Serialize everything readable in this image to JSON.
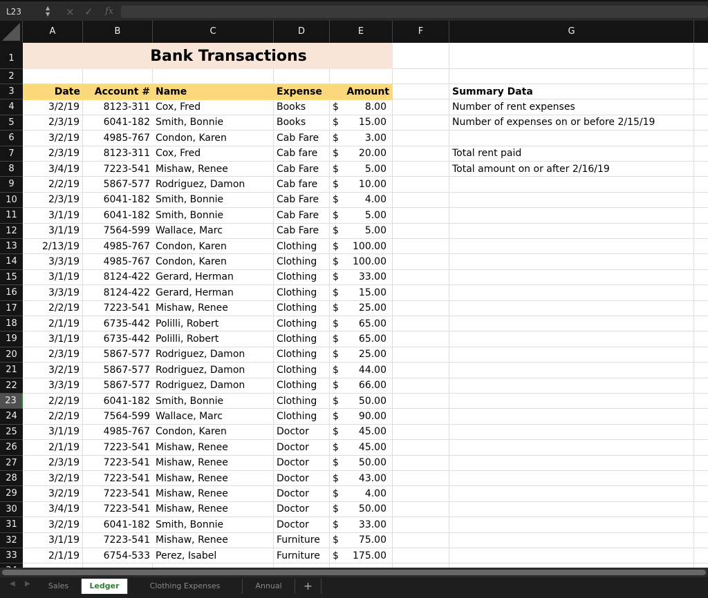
{
  "formula_bar": {
    "name_box": "L23",
    "cancel_icon": "×",
    "enter_icon": "✓",
    "fx_label": "fx",
    "formula": ""
  },
  "columns": [
    "A",
    "B",
    "C",
    "D",
    "E",
    "F",
    "G"
  ],
  "title": "Bank Transactions",
  "headers": {
    "date": "Date",
    "account": "Account #",
    "name": "Name",
    "expense": "Expense",
    "amount": "Amount"
  },
  "rows": [
    [
      "3/2/19",
      "8123-311",
      "Cox, Fred",
      "Books",
      "8.00"
    ],
    [
      "2/3/19",
      "6041-182",
      "Smith, Bonnie",
      "Books",
      "15.00"
    ],
    [
      "3/2/19",
      "4985-767",
      "Condon, Karen",
      "Cab Fare",
      "3.00"
    ],
    [
      "2/3/19",
      "8123-311",
      "Cox, Fred",
      "Cab fare",
      "20.00"
    ],
    [
      "3/4/19",
      "7223-541",
      "Mishaw, Renee",
      "Cab Fare",
      "5.00"
    ],
    [
      "2/2/19",
      "5867-577",
      "Rodriguez, Damon",
      "Cab fare",
      "10.00"
    ],
    [
      "2/3/19",
      "6041-182",
      "Smith, Bonnie",
      "Cab Fare",
      "4.00"
    ],
    [
      "3/1/19",
      "6041-182",
      "Smith, Bonnie",
      "Cab Fare",
      "5.00"
    ],
    [
      "3/1/19",
      "7564-599",
      "Wallace, Marc",
      "Cab Fare",
      "5.00"
    ],
    [
      "2/13/19",
      "4985-767",
      "Condon, Karen",
      "Clothing",
      "100.00"
    ],
    [
      "3/3/19",
      "4985-767",
      "Condon, Karen",
      "Clothing",
      "100.00"
    ],
    [
      "3/1/19",
      "8124-422",
      "Gerard, Herman",
      "Clothing",
      "33.00"
    ],
    [
      "3/3/19",
      "8124-422",
      "Gerard, Herman",
      "Clothing",
      "15.00"
    ],
    [
      "2/2/19",
      "7223-541",
      "Mishaw, Renee",
      "Clothing",
      "25.00"
    ],
    [
      "2/1/19",
      "6735-442",
      "Polilli, Robert",
      "Clothing",
      "65.00"
    ],
    [
      "3/1/19",
      "6735-442",
      "Polilli, Robert",
      "Clothing",
      "65.00"
    ],
    [
      "2/3/19",
      "5867-577",
      "Rodriguez, Damon",
      "Clothing",
      "25.00"
    ],
    [
      "3/2/19",
      "5867-577",
      "Rodriguez, Damon",
      "Clothing",
      "44.00"
    ],
    [
      "3/3/19",
      "5867-577",
      "Rodriguez, Damon",
      "Clothing",
      "66.00"
    ],
    [
      "2/2/19",
      "6041-182",
      "Smith, Bonnie",
      "Clothing",
      "50.00"
    ],
    [
      "2/2/19",
      "7564-599",
      "Wallace, Marc",
      "Clothing",
      "90.00"
    ],
    [
      "3/1/19",
      "4985-767",
      "Condon, Karen",
      "Doctor",
      "45.00"
    ],
    [
      "2/1/19",
      "7223-541",
      "Mishaw, Renee",
      "Doctor",
      "45.00"
    ],
    [
      "2/3/19",
      "7223-541",
      "Mishaw, Renee",
      "Doctor",
      "50.00"
    ],
    [
      "3/2/19",
      "7223-541",
      "Mishaw, Renee",
      "Doctor",
      "43.00"
    ],
    [
      "3/2/19",
      "7223-541",
      "Mishaw, Renee",
      "Doctor",
      "4.00"
    ],
    [
      "3/4/19",
      "7223-541",
      "Mishaw, Renee",
      "Doctor",
      "50.00"
    ],
    [
      "3/2/19",
      "6041-182",
      "Smith, Bonnie",
      "Doctor",
      "33.00"
    ],
    [
      "3/1/19",
      "7223-541",
      "Mishaw, Renee",
      "Furniture",
      "75.00"
    ],
    [
      "2/1/19",
      "6754-533",
      "Perez, Isabel",
      "Furniture",
      "175.00"
    ]
  ],
  "currency_symbol": "$",
  "summary": {
    "title": "Summary Data",
    "items": [
      "Number of rent expenses",
      "Number of expenses on or before 2/15/19",
      "",
      "Total rent paid",
      "Total amount on or after 2/16/19"
    ]
  },
  "selected_row": 23,
  "sheet_tabs": [
    "Sales",
    "Ledger",
    "Clothing Expenses",
    "Annual"
  ],
  "active_tab": "Ledger",
  "add_sheet_label": "+",
  "colors": {
    "title_fill": "#f9e4d8",
    "header_fill": "#fbd97a",
    "active_tab_text": "#2e7d32"
  }
}
